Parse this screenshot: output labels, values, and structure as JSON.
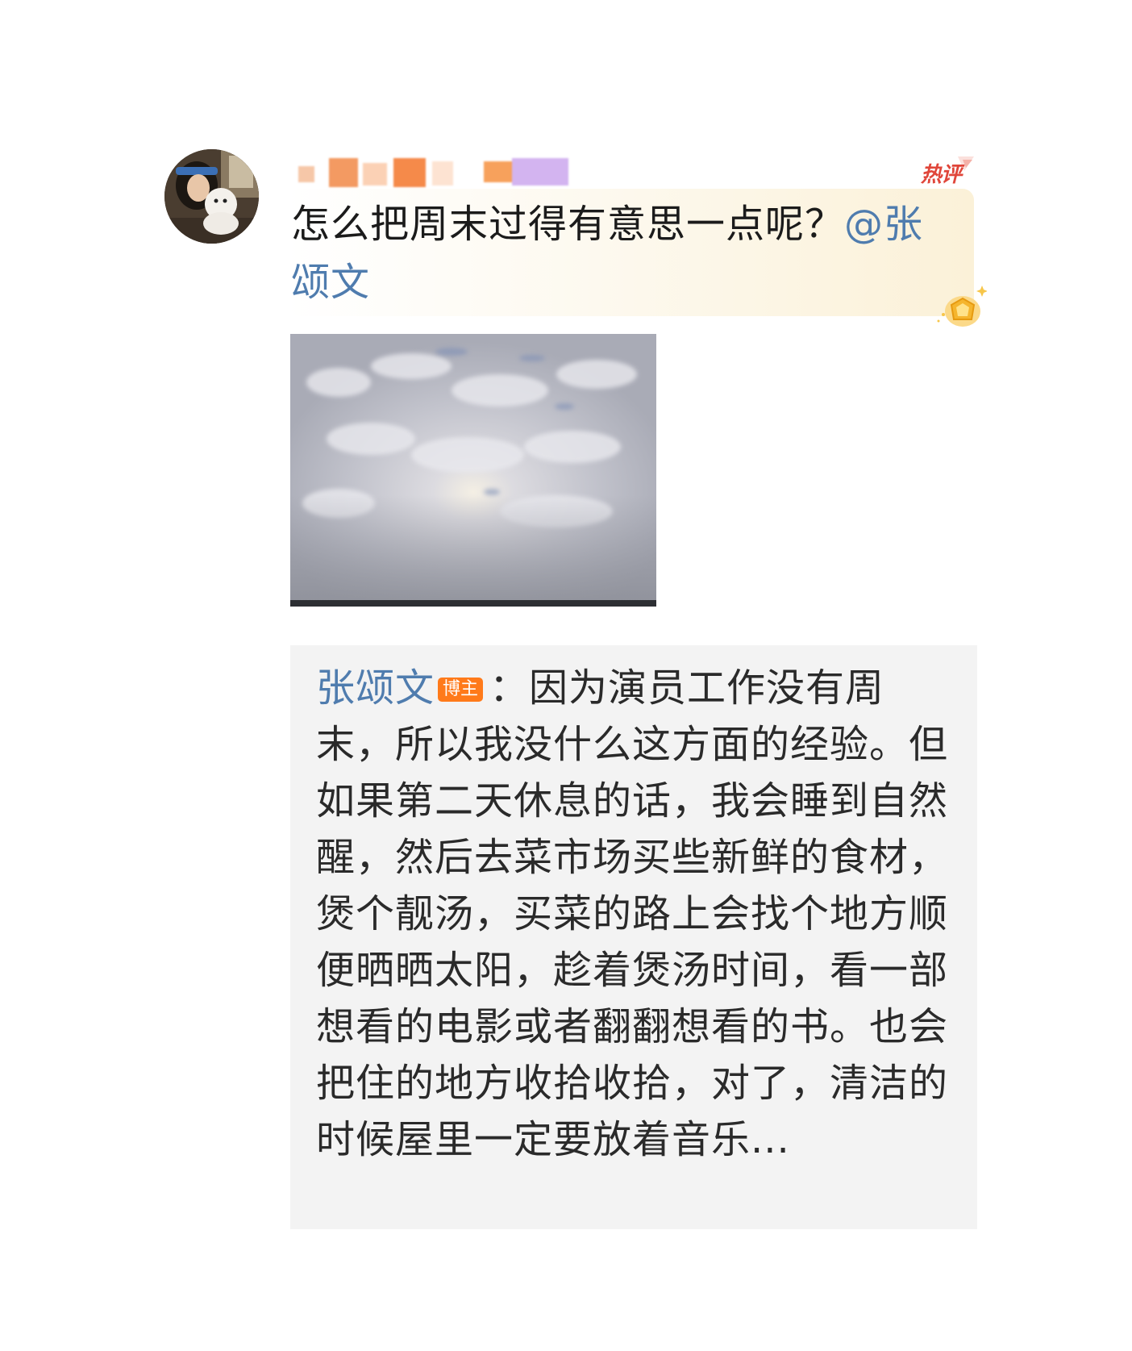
{
  "post": {
    "text": "怎么把周末过得有意思一点呢？",
    "mention": "@张颂文"
  },
  "hot_badge": {
    "label": "热评"
  },
  "reply": {
    "author": "张颂文",
    "badge": "博主",
    "separator": "：",
    "text": "因为演员工作没有周末，所以我没什么这方面的经验。但如果第二天休息的话，我会睡到自然醒，然后去菜市场买些新鲜的食材，煲个靓汤，买菜的路上会找个地方顺便晒晒太阳，趁着煲汤时间，看一部想看的电影或者翻翻想看的书。也会把住的地方收拾收拾，对了，清洁的时候屋里一定要放着音乐..."
  },
  "colors": {
    "mention": "#4f7cae",
    "hot_badge": "#e0463a",
    "blogger_badge": "#ff7a1a",
    "reply_background": "#f3f3f3"
  },
  "icons": [
    "user-avatar",
    "hot-comment-badge",
    "trophy-icon",
    "blurred-username"
  ]
}
